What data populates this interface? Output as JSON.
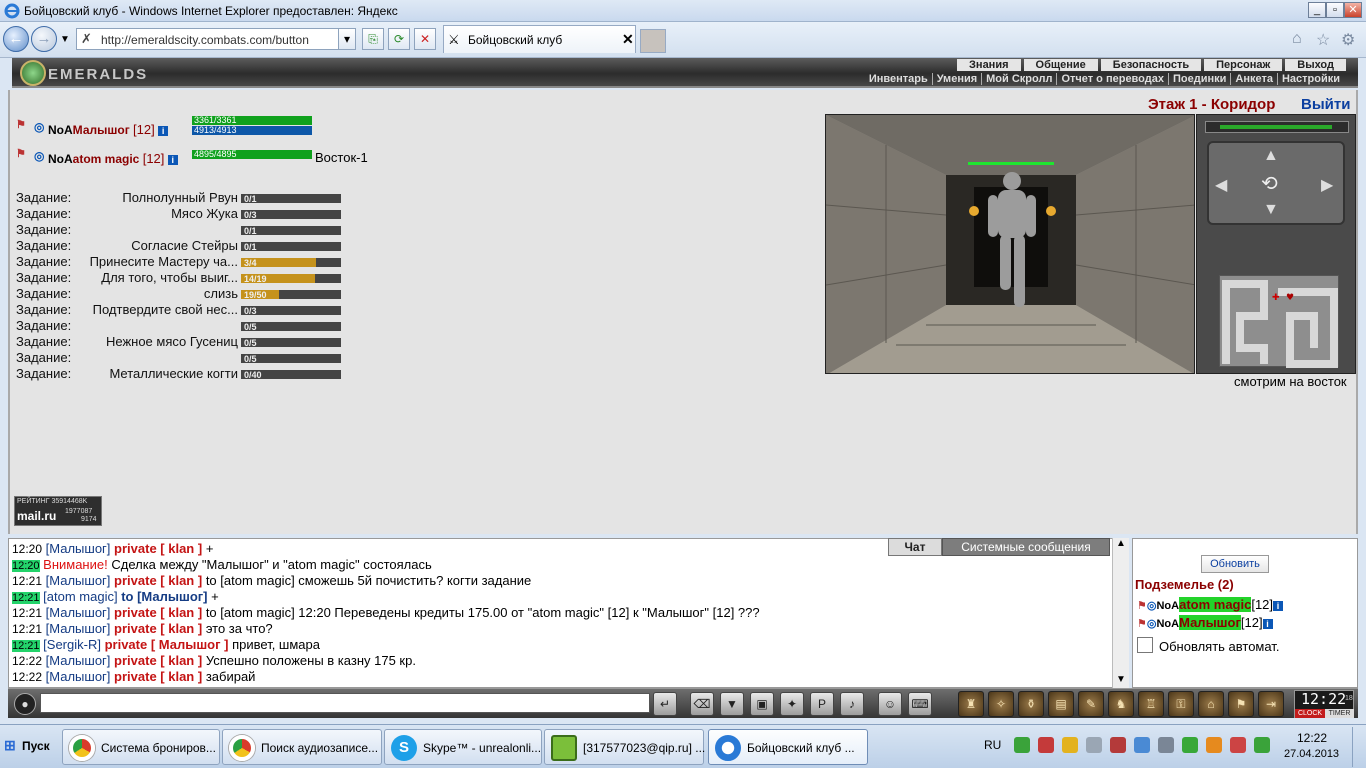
{
  "window": {
    "title": "Бойцовский клуб - Windows Internet Explorer предоставлен: Яндекс"
  },
  "browser": {
    "url": "http://emeraldscity.combats.com/button",
    "tab_label": "Бойцовский клуб",
    "tab_close": "✕"
  },
  "game_header": {
    "logo": "EMERALDS",
    "menu_top": [
      "Знания",
      "Общение",
      "Безопасность",
      "Персонаж",
      "Выход"
    ],
    "menu_bottom": [
      "Инвентарь",
      "Умения",
      "Мой Скролл",
      "Отчет о переводах",
      "Поединки",
      "Анкета",
      "Настройки"
    ]
  },
  "location": {
    "title": "Этаж 1 - Коридор",
    "exit": "Выйти",
    "facing": "смотрим на восток"
  },
  "party": [
    {
      "prefix": "NoA",
      "name": "Малышог",
      "level": "[12]",
      "hp": "3361/3361",
      "hp_fill": 1.0,
      "mana": "4913/4913",
      "mana_fill": 1.0,
      "extra": ""
    },
    {
      "prefix": "NoA",
      "name": "atom magic",
      "level": "[12]",
      "hp": "4895/4895",
      "hp_fill": 1.0,
      "mana": "",
      "extra": "Восток-1"
    }
  ],
  "quests": {
    "label": "Задание:",
    "items": [
      {
        "name": "Полнолунный Рвун",
        "progress": "0/1",
        "fill": 0
      },
      {
        "name": "Мясо Жука",
        "progress": "0/3",
        "fill": 0
      },
      {
        "name": "",
        "progress": "0/1",
        "fill": 0
      },
      {
        "name": "Согласие Стейры",
        "progress": "0/1",
        "fill": 0
      },
      {
        "name": "Принесите Мастеру ча...",
        "progress": "3/4",
        "fill": 0.75
      },
      {
        "name": "Для того, чтобы выиг...",
        "progress": "14/19",
        "fill": 0.74
      },
      {
        "name": "слизь",
        "progress": "19/50",
        "fill": 0.38
      },
      {
        "name": "Подтвердите свой нес...",
        "progress": "0/3",
        "fill": 0
      },
      {
        "name": "",
        "progress": "0/5",
        "fill": 0
      },
      {
        "name": "Нежное мясо Гусениц",
        "progress": "0/5",
        "fill": 0
      },
      {
        "name": "",
        "progress": "0/5",
        "fill": 0
      },
      {
        "name": "Металлические когти",
        "progress": "0/40",
        "fill": 0
      }
    ]
  },
  "rating": {
    "label": "РЕЙТИНГ",
    "value": "35914468K",
    "brand": "mail.ru",
    "num1": "1977087",
    "num2": "9174"
  },
  "chat": {
    "tabs": [
      "Чат",
      "Системные сообщения"
    ],
    "lines": [
      {
        "time": "12:20",
        "time_hl": false,
        "name": "[Малышог]",
        "private": "private [ klan ]",
        "text": "+"
      },
      {
        "time": "12:20",
        "time_hl": true,
        "warn": "Внимание!",
        "text": "Сделка между \"Малышог\" и \"atom magic\" состоялась"
      },
      {
        "time": "12:21",
        "time_hl": false,
        "name": "[Малышог]",
        "private": "private [ klan ]",
        "text": "to [atom magic] сможешь 5й почистить? когти задание"
      },
      {
        "time": "12:21",
        "time_hl": true,
        "name": "[atom magic]",
        "to": "to [Малышог]",
        "text": "+"
      },
      {
        "time": "12:21",
        "time_hl": false,
        "name": "[Малышог]",
        "private": "private [ klan ]",
        "text": "to [atom magic] 12:20 Переведены кредиты 175.00 от \"atom magic\" [12] к \"Малышог\" [12] ???"
      },
      {
        "time": "12:21",
        "time_hl": false,
        "name": "[Малышог]",
        "private": "private [ klan ]",
        "text": "это за что?"
      },
      {
        "time": "12:21",
        "time_hl": true,
        "name": "[Sergik-R]",
        "private": "private [ Малышог ]",
        "text": "привет, шмара"
      },
      {
        "time": "12:22",
        "time_hl": false,
        "name": "[Малышог]",
        "private": "private [ klan ]",
        "text": "Успешно положены в казну 175 кр."
      },
      {
        "time": "12:22",
        "time_hl": false,
        "name": "[Малышог]",
        "private": "private [ klan ]",
        "text": "забирай"
      }
    ]
  },
  "online": {
    "refresh": "Обновить",
    "title": "Подземелье (2)",
    "users": [
      {
        "prefix": "NoA",
        "name": "atom magic",
        "level": "[12]"
      },
      {
        "prefix": "NoA",
        "name": "Малышог",
        "level": "[12]"
      }
    ],
    "auto_label": "Обновлять автомат."
  },
  "toolbar": {
    "clock": "12:22",
    "clock_sub": "18",
    "clock_btn": "CLOCK",
    "timer_btn": "TIMER"
  },
  "taskbar": {
    "start": "Пуск",
    "tasks": [
      "Система брониров...",
      "Поиск аудиозаписе...",
      "Skype™ - unrealonli...",
      "[317577023@qip.ru] ...",
      "Бойцовский клуб ..."
    ],
    "lang": "RU",
    "time": "12:22",
    "date": "27.04.2013"
  },
  "colors": {
    "hp": "#0fa11d",
    "mana": "#0d57a8",
    "quest_fill": "#c5921c",
    "chat_name": "#153c84",
    "chat_private": "#c41414"
  }
}
